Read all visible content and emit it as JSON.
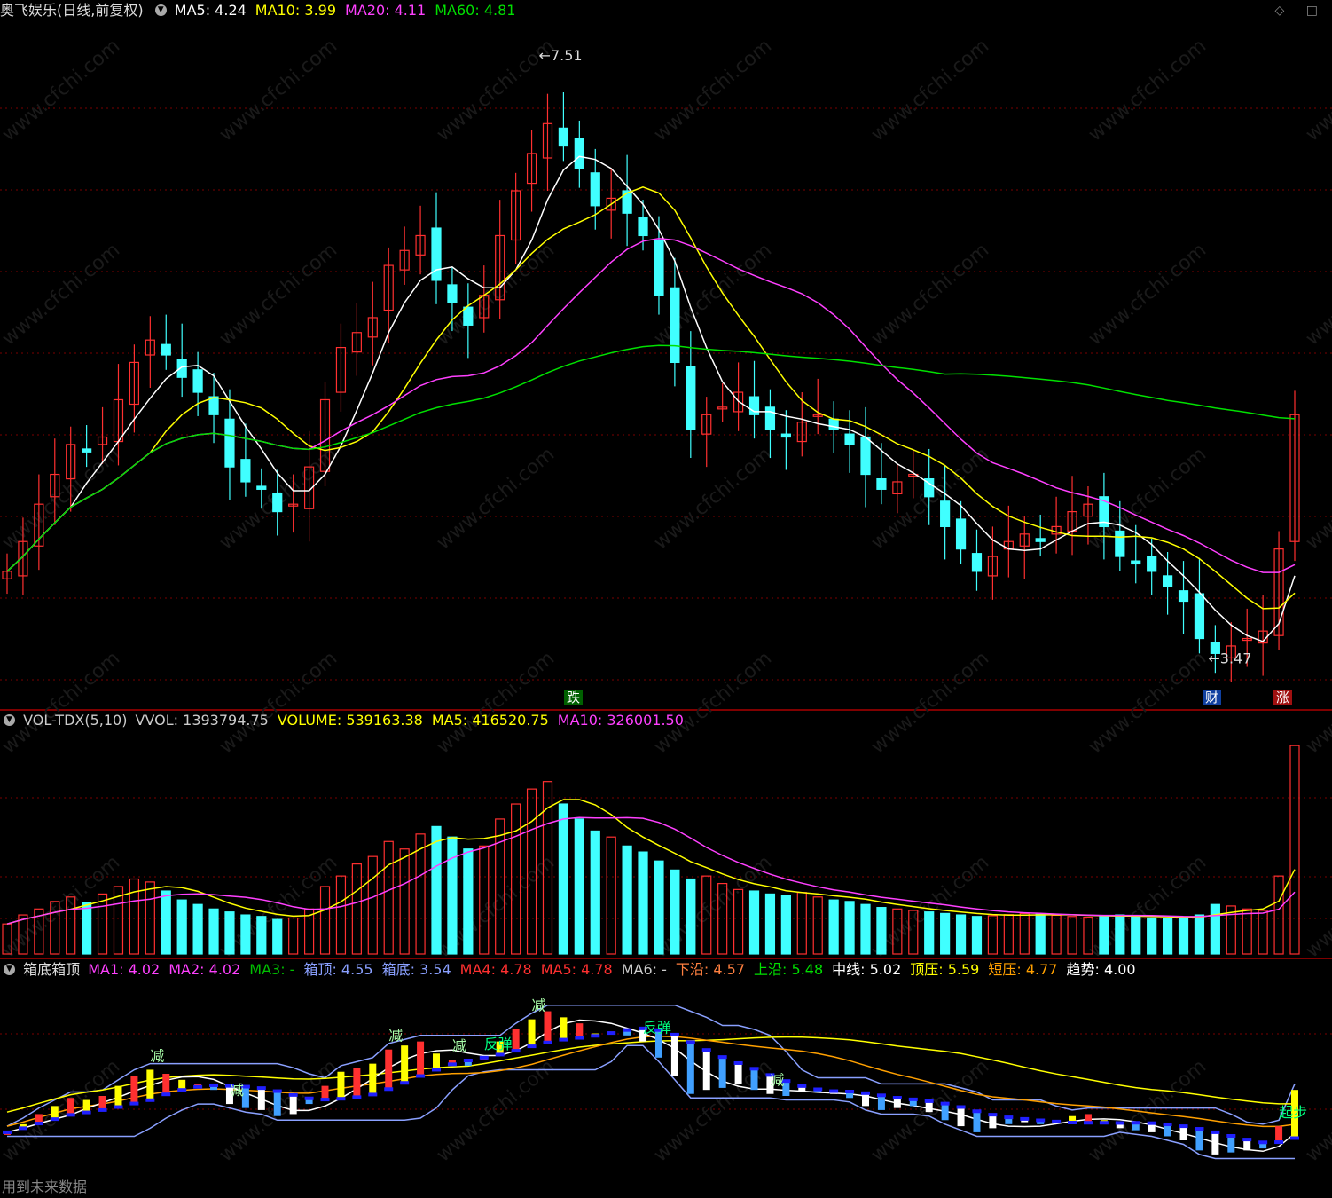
{
  "header_main": {
    "title": "奥飞娱乐(日线,前复权)",
    "items": [
      {
        "label": "MA5: 4.24",
        "color": "#ffffff"
      },
      {
        "label": "MA10: 3.99",
        "color": "#ffff00"
      },
      {
        "label": "MA20: 4.11",
        "color": "#ff40ff"
      },
      {
        "label": "MA60: 4.81",
        "color": "#00e000"
      }
    ]
  },
  "header_vol": {
    "title": "VOL-TDX(5,10)",
    "items": [
      {
        "label": "VVOL: 1393794.75",
        "color": "#cccccc"
      },
      {
        "label": "VOLUME: 539163.38",
        "color": "#ffff00"
      },
      {
        "label": "MA5: 416520.75",
        "color": "#ffff00"
      },
      {
        "label": "MA10: 326001.50",
        "color": "#ff40ff"
      }
    ]
  },
  "header_box": {
    "title": "箱底箱顶",
    "items": [
      {
        "label": "MA1: 4.02",
        "color": "#ff40ff"
      },
      {
        "label": "MA2: 4.02",
        "color": "#ff40ff"
      },
      {
        "label": "MA3: -",
        "color": "#00c000"
      },
      {
        "label": "箱顶: 4.55",
        "color": "#8aa0ff"
      },
      {
        "label": "箱底: 3.54",
        "color": "#8aa0ff"
      },
      {
        "label": "MA4: 4.78",
        "color": "#ff3030"
      },
      {
        "label": "MA5: 4.78",
        "color": "#ff3030"
      },
      {
        "label": "MA6: -",
        "color": "#cccccc"
      },
      {
        "label": "下沿: 4.57",
        "color": "#ff8040"
      },
      {
        "label": "上沿: 5.48",
        "color": "#00e000"
      },
      {
        "label": "中线: 5.02",
        "color": "#ffffff"
      },
      {
        "label": "顶压: 5.59",
        "color": "#ffff00"
      },
      {
        "label": "短压: 4.77",
        "color": "#ffa000"
      },
      {
        "label": "趋势: 4.00",
        "color": "#ffffff"
      }
    ]
  },
  "annotations": {
    "high_label": "7.51",
    "low_label": "3.47",
    "marker_die": "跌",
    "marker_cai": "财",
    "marker_zhang": "涨",
    "box_texts": [
      "减",
      "减",
      "减",
      "减",
      "减",
      "减",
      "反弹",
      "反弹",
      "起步"
    ]
  },
  "footer_text": "用到未来数据",
  "watermark": "www.cfchi.com",
  "colors": {
    "up": "#ff3030",
    "down": "#40ffff",
    "grid": "#7a0000",
    "ma5": "#ffffff",
    "ma10": "#ffff00",
    "ma20": "#ff40ff",
    "ma60": "#00e000"
  },
  "chart_data": [
    {
      "type": "candlestick",
      "title": "奥飞娱乐(日线,前复权)",
      "y_range": [
        3.3,
        7.7
      ],
      "high": 7.51,
      "low": 3.47,
      "close_series": [
        4.05,
        4.25,
        4.5,
        4.7,
        4.9,
        4.85,
        4.95,
        5.2,
        5.45,
        5.6,
        5.5,
        5.35,
        5.25,
        5.1,
        4.75,
        4.65,
        4.6,
        4.45,
        4.5,
        4.75,
        5.2,
        5.55,
        5.65,
        5.75,
        6.1,
        6.2,
        6.3,
        6.0,
        5.85,
        5.7,
        5.9,
        6.3,
        6.6,
        6.85,
        7.05,
        6.9,
        6.75,
        6.5,
        6.55,
        6.45,
        6.3,
        5.9,
        5.45,
        5.0,
        5.1,
        5.15,
        5.25,
        5.1,
        5.0,
        4.95,
        5.05,
        5.1,
        5.0,
        4.9,
        4.7,
        4.6,
        4.65,
        4.7,
        4.55,
        4.35,
        4.2,
        4.05,
        4.15,
        4.25,
        4.3,
        4.25,
        4.35,
        4.45,
        4.5,
        4.35,
        4.15,
        4.1,
        4.05,
        3.95,
        3.85,
        3.6,
        3.5,
        3.55,
        3.6,
        3.65,
        4.2,
        5.1
      ]
    },
    {
      "type": "bar",
      "title": "VOL-TDX(5,10)",
      "values": [
        200,
        260,
        300,
        350,
        380,
        340,
        400,
        450,
        500,
        480,
        420,
        360,
        330,
        300,
        280,
        260,
        250,
        230,
        240,
        300,
        450,
        520,
        600,
        650,
        750,
        700,
        800,
        850,
        780,
        700,
        720,
        900,
        1000,
        1100,
        1150,
        1000,
        900,
        820,
        780,
        720,
        680,
        620,
        560,
        500,
        520,
        470,
        430,
        420,
        400,
        390,
        410,
        380,
        360,
        350,
        330,
        310,
        300,
        290,
        280,
        270,
        260,
        250,
        255,
        262,
        270,
        265,
        258,
        250,
        245,
        255,
        260,
        250,
        240,
        235,
        240,
        260,
        330,
        320,
        300,
        290,
        520,
        1390
      ]
    }
  ]
}
